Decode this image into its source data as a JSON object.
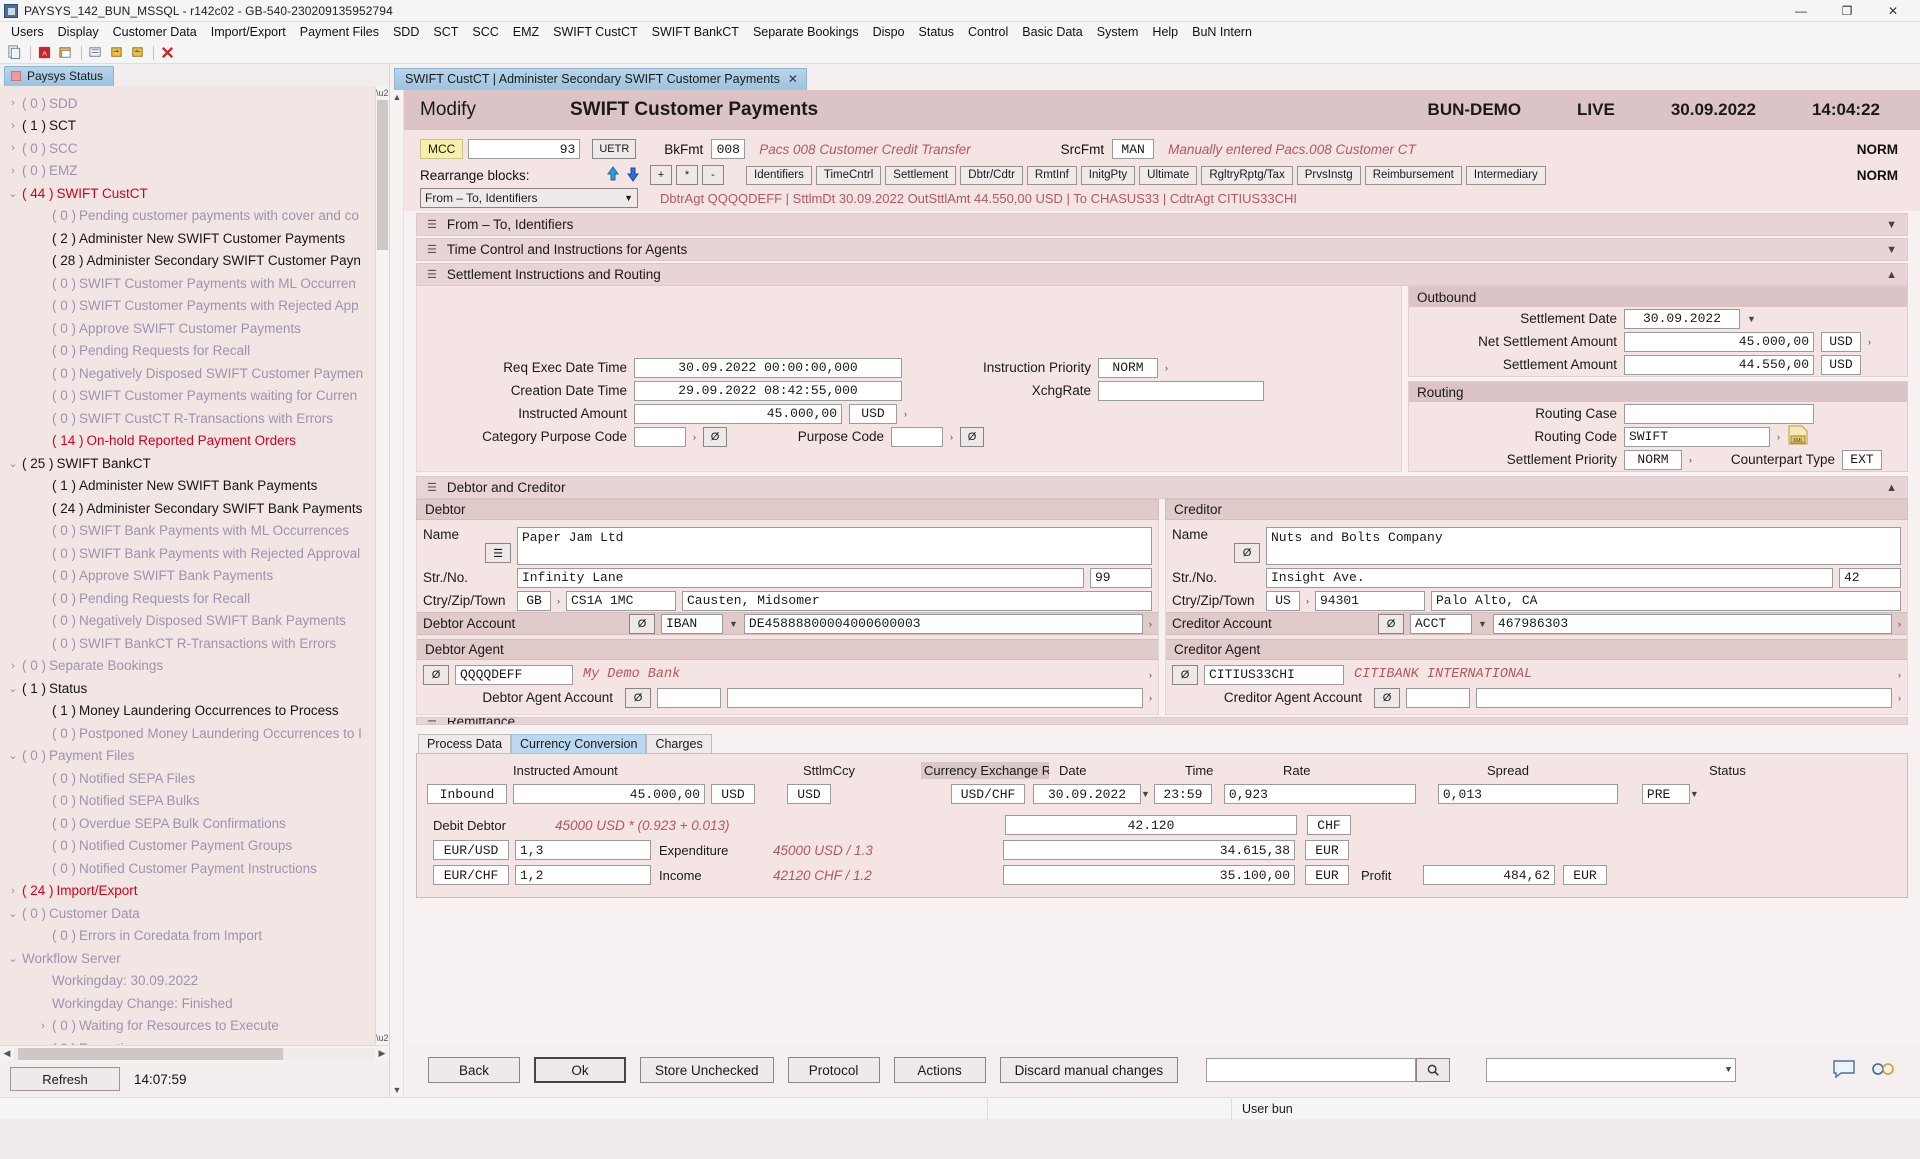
{
  "window": {
    "title": "PAYSYS_142_BUN_MSSQL - r142c02 - GB-540-230209135952794",
    "minimize": "—",
    "maximize": "❐",
    "close": "✕"
  },
  "menubar": [
    "Users",
    "Display",
    "Customer Data",
    "Import/Export",
    "Payment Files",
    "SDD",
    "SCT",
    "SCC",
    "EMZ",
    "SWIFT CustCT",
    "SWIFT BankCT",
    "Separate Bookings",
    "Dispo",
    "Status",
    "Control",
    "Basic Data",
    "System",
    "Help",
    "BuN Intern"
  ],
  "toolbar": {
    "icons": [
      "copy-icon",
      "pdf-icon",
      "print-icon",
      "attach-icon",
      "import-icon",
      "export-icon",
      "delete-icon"
    ],
    "glyphs": [
      "⎘",
      "■",
      "⎙",
      "⌘",
      "↩",
      "↪",
      "✕"
    ]
  },
  "sidebar": {
    "tab": "Paysys Status",
    "tree": [
      {
        "w": "›",
        "count": "( 0 )",
        "label": "SDD",
        "style": "dim",
        "level": 1
      },
      {
        "w": "›",
        "count": "( 1 )",
        "label": "SCT",
        "style": "bold",
        "level": 1
      },
      {
        "w": "›",
        "count": "( 0 )",
        "label": "SCC",
        "style": "dim",
        "level": 1
      },
      {
        "w": "›",
        "count": "( 0 )",
        "label": "EMZ",
        "style": "dim",
        "level": 1
      },
      {
        "w": "⌄",
        "count": "( 44 )",
        "label": "SWIFT CustCT",
        "style": "red",
        "level": 1
      },
      {
        "w": "",
        "count": "( 0 )",
        "label": "Pending customer payments with cover and co",
        "style": "dim",
        "level": 2
      },
      {
        "w": "",
        "count": "( 2 )",
        "label": "Administer New SWIFT Customer Payments",
        "style": "bold",
        "level": 2
      },
      {
        "w": "",
        "count": "( 28 )",
        "label": "Administer Secondary SWIFT Customer Payn",
        "style": "bold",
        "level": 2
      },
      {
        "w": "",
        "count": "( 0 )",
        "label": "SWIFT Customer Payments with ML Occurren",
        "style": "dim",
        "level": 2
      },
      {
        "w": "",
        "count": "( 0 )",
        "label": "SWIFT Customer Payments with Rejected App",
        "style": "dim",
        "level": 2
      },
      {
        "w": "",
        "count": "( 0 )",
        "label": "Approve SWIFT Customer Payments",
        "style": "dim",
        "level": 2
      },
      {
        "w": "",
        "count": "( 0 )",
        "label": "Pending Requests for Recall",
        "style": "dim",
        "level": 2
      },
      {
        "w": "",
        "count": "( 0 )",
        "label": "Negatively Disposed SWIFT Customer Paymen",
        "style": "dim",
        "level": 2
      },
      {
        "w": "",
        "count": "( 0 )",
        "label": "SWIFT Customer Payments waiting for Curren",
        "style": "dim",
        "level": 2
      },
      {
        "w": "",
        "count": "( 0 )",
        "label": "SWIFT CustCT R-Transactions with Errors",
        "style": "dim",
        "level": 2
      },
      {
        "w": "",
        "count": "( 14 )",
        "label": "On-hold Reported Payment Orders",
        "style": "red",
        "level": 2
      },
      {
        "w": "⌄",
        "count": "( 25 )",
        "label": "SWIFT BankCT",
        "style": "bold",
        "level": 1
      },
      {
        "w": "",
        "count": "( 1 )",
        "label": "Administer New SWIFT Bank Payments",
        "style": "bold",
        "level": 2
      },
      {
        "w": "",
        "count": "( 24 )",
        "label": "Administer Secondary SWIFT Bank Payments",
        "style": "bold",
        "level": 2
      },
      {
        "w": "",
        "count": "( 0 )",
        "label": "SWIFT Bank Payments with ML Occurrences",
        "style": "dim",
        "level": 2
      },
      {
        "w": "",
        "count": "( 0 )",
        "label": "SWIFT Bank Payments with Rejected Approval",
        "style": "dim",
        "level": 2
      },
      {
        "w": "",
        "count": "( 0 )",
        "label": "Approve SWIFT Bank Payments",
        "style": "dim",
        "level": 2
      },
      {
        "w": "",
        "count": "( 0 )",
        "label": "Pending Requests for Recall",
        "style": "dim",
        "level": 2
      },
      {
        "w": "",
        "count": "( 0 )",
        "label": "Negatively Disposed SWIFT Bank Payments",
        "style": "dim",
        "level": 2
      },
      {
        "w": "",
        "count": "( 0 )",
        "label": "SWIFT BankCT R-Transactions with Errors",
        "style": "dim",
        "level": 2
      },
      {
        "w": "›",
        "count": "( 0 )",
        "label": "Separate Bookings",
        "style": "dim",
        "level": 1
      },
      {
        "w": "⌄",
        "count": "( 1 )",
        "label": "Status",
        "style": "bold",
        "level": 1
      },
      {
        "w": "",
        "count": "( 1 )",
        "label": "Money Laundering Occurrences to Process",
        "style": "bold",
        "level": 2
      },
      {
        "w": "",
        "count": "( 0 )",
        "label": "Postponed Money Laundering Occurrences to I",
        "style": "dim",
        "level": 2
      },
      {
        "w": "⌄",
        "count": "( 0 )",
        "label": "Payment Files",
        "style": "dim",
        "level": 1
      },
      {
        "w": "",
        "count": "( 0 )",
        "label": "Notified SEPA Files",
        "style": "dim",
        "level": 2
      },
      {
        "w": "",
        "count": "( 0 )",
        "label": "Notified SEPA Bulks",
        "style": "dim",
        "level": 2
      },
      {
        "w": "",
        "count": "( 0 )",
        "label": "Overdue SEPA Bulk Confirmations",
        "style": "dim",
        "level": 2
      },
      {
        "w": "",
        "count": "( 0 )",
        "label": "Notified Customer Payment Groups",
        "style": "dim",
        "level": 2
      },
      {
        "w": "",
        "count": "( 0 )",
        "label": "Notified Customer Payment Instructions",
        "style": "dim",
        "level": 2
      },
      {
        "w": "›",
        "count": "( 24 )",
        "label": "Import/Export",
        "style": "red",
        "level": 1
      },
      {
        "w": "⌄",
        "count": "( 0 )",
        "label": "Customer Data",
        "style": "dim",
        "level": 1
      },
      {
        "w": "",
        "count": "( 0 )",
        "label": "Errors in Coredata from Import",
        "style": "dim",
        "level": 2
      },
      {
        "w": "⌄",
        "count": "",
        "label": "Workflow Server",
        "style": "dim",
        "level": 1
      },
      {
        "w": "",
        "count": "",
        "label": "Workingday: 30.09.2022",
        "style": "dim",
        "level": 2
      },
      {
        "w": "",
        "count": "",
        "label": "Workingday Change: Finished",
        "style": "dim",
        "level": 2
      },
      {
        "w": "›",
        "count": "( 0 )",
        "label": "Waiting for Resources to Execute",
        "style": "dim",
        "level": 2
      },
      {
        "w": "",
        "count": "( 0 )",
        "label": "Executing",
        "style": "dim",
        "level": 2
      }
    ],
    "refresh_label": "Refresh",
    "time": "14:07:59"
  },
  "doc_tab": {
    "label": "SWIFT CustCT | Administer Secondary SWIFT Customer Payments",
    "close": "✕"
  },
  "header": {
    "mode": "Modify",
    "title": "SWIFT Customer Payments",
    "env": "BUN-DEMO",
    "live": "LIVE",
    "date": "30.09.2022",
    "time": "14:04:22"
  },
  "idrow": {
    "mcc_label": "MCC",
    "mcc_value": "93",
    "uetr_label": "UETR",
    "bkfmt_label": "BkFmt",
    "bkfmt_value": "008",
    "bkfmt_desc": "Pacs 008  Customer Credit Transfer",
    "srcfmt_label": "SrcFmt",
    "srcfmt_value": "MAN",
    "srcfmt_desc": "Manually entered Pacs.008 Customer CT",
    "norm1": "NORM",
    "norm2": "NORM"
  },
  "rearrange": {
    "label": "Rearrange blocks:",
    "up": "⬆",
    "down": "⬇",
    "plus": "+",
    "star": "*",
    "minus": "-",
    "blocks": [
      "Identifiers",
      "TimeCntrl",
      "Settlement",
      "Dbtr/Cdtr",
      "RmtInf",
      "InitgPty",
      "Ultimate",
      "RgltryRptg/Tax",
      "PrvsInstg",
      "Reimbursement",
      "Intermediary"
    ],
    "select_value": "From – To, Identifiers",
    "summary": "DbtrAgt QQQQDEFF  |  SttlmDt 30.09.2022 OutSttlAmt 44.550,00 USD  |  To CHASUS33  |  CdtrAgt CITIUS33CHI"
  },
  "sections": {
    "from_to": "From – To, Identifiers",
    "time_control": "Time Control and Instructions for Agents",
    "settlement": "Settlement Instructions and Routing",
    "debtor_creditor": "Debtor and Creditor",
    "remittance": "Remittance"
  },
  "settlement_left": {
    "req_exec_label": "Req Exec Date Time",
    "req_exec_value": "30.09.2022 00:00:00,000",
    "creation_label": "Creation Date Time",
    "creation_value": "29.09.2022 08:42:55,000",
    "instructed_label": "Instructed Amount",
    "instructed_value": "45.000,00",
    "instructed_ccy": "USD",
    "catpurp_label": "Category Purpose  Code",
    "catpurp_value": "",
    "purp_label": "Purpose  Code",
    "purp_value": "",
    "instr_prio_label": "Instruction Priority",
    "instr_prio_value": "NORM",
    "xchg_label": "XchgRate",
    "xchg_value": ""
  },
  "outbound": {
    "title": "Outbound",
    "settlement_date_label": "Settlement Date",
    "settlement_date_value": "30.09.2022",
    "net_amount_label": "Net Settlement Amount",
    "net_amount_value": "45.000,00",
    "net_ccy": "USD",
    "amount_label": "Settlement Amount",
    "amount_value": "44.550,00",
    "ccy": "USD"
  },
  "routing": {
    "title": "Routing",
    "case_label": "Routing Case",
    "case_value": "",
    "code_label": "Routing Code",
    "code_value": "SWIFT",
    "xml_icon": "XML",
    "priority_label": "Settlement Priority",
    "priority_value": "NORM",
    "counterpart_label": "Counterpart Type",
    "counterpart_value": "EXT"
  },
  "debtor": {
    "title": "Debtor",
    "name_label": "Name",
    "name_value": "Paper Jam Ltd",
    "str_label": "Str./No.",
    "str_value": "Infinity Lane",
    "no_value": "99",
    "ctry_label": "Ctry/Zip/Town",
    "ctry_value": "GB",
    "zip_value": "CS1A 1MC",
    "town_value": "Causten, Midsomer",
    "account_label": "Debtor Account",
    "account_type": "IBAN",
    "account_value": "DE45888800004000600003",
    "agent_title": "Debtor Agent",
    "agent_bic": "QQQQDEFF",
    "agent_name": "My Demo Bank",
    "agent_account_label": "Debtor Agent Account",
    "agent_account_value": ""
  },
  "creditor": {
    "title": "Creditor",
    "name_label": "Name",
    "name_value": "Nuts and Bolts Company",
    "str_label": "Str./No.",
    "str_value": "Insight Ave.",
    "no_value": "42",
    "ctry_label": "Ctry/Zip/Town",
    "ctry_value": "US",
    "zip_value": "94301",
    "town_value": "Palo Alto, CA",
    "account_label": "Creditor Account",
    "account_type": "ACCT",
    "account_value": "467986303",
    "agent_title": "Creditor Agent",
    "agent_bic": "CITIUS33CHI",
    "agent_name": "CITIBANK INTERNATIONAL",
    "agent_account_label": "Creditor Agent Account",
    "agent_account_value": ""
  },
  "bottom_tabs": [
    {
      "label": "Process Data",
      "active": false
    },
    {
      "label": "Currency Conversion",
      "active": true
    },
    {
      "label": "Charges",
      "active": false
    }
  ],
  "conversion": {
    "inbound": "Inbound",
    "instructed_amount_label": "Instructed Amount",
    "instructed_amount_value": "45.000,00",
    "instructed_ccy": "USD",
    "sttlm_ccy_label": "SttlmCcy",
    "sttlm_ccy_value": "USD",
    "fx_rate_label": "Currency Exchange Rat",
    "fx_pair": "USD/CHF",
    "date_label": "Date",
    "date_value": "30.09.2022",
    "time_label": "Time",
    "time_value": "23:59",
    "rate_label": "Rate",
    "rate_value": "0,923",
    "spread_label": "Spread",
    "spread_value": "0,013",
    "status_label": "Status",
    "status_value": "PRE",
    "debit_debtor_label": "Debit Debtor",
    "debit_formula": "45000 USD * (0.923 + 0.013)",
    "debit_value": "42.120",
    "debit_ccy": "CHF",
    "eurusd_label": "EUR/USD",
    "eurusd_value": "1,3",
    "eurchf_label": "EUR/CHF",
    "eurchf_value": "1,2",
    "expenditure_label": "Expenditure",
    "expenditure_formula": "45000 USD / 1.3",
    "expenditure_value": "34.615,38",
    "expenditure_ccy": "EUR",
    "income_label": "Income",
    "income_formula": "42120 CHF / 1.2",
    "income_value": "35.100,00",
    "income_ccy": "EUR",
    "profit_label": "Profit",
    "profit_value": "484,62",
    "profit_ccy": "EUR"
  },
  "footer": {
    "buttons": [
      "Back",
      "Ok",
      "Store Unchecked",
      "Protocol",
      "Actions",
      "Discard manual changes"
    ],
    "search_value": "",
    "search_icon": "⌕",
    "dropdown_value": "",
    "chat_icon": "⌨",
    "tools_icon": "⚙"
  },
  "statusbar": {
    "user": "User bun"
  },
  "colors": {
    "accent": "#dcc3c6",
    "yellow": "#f7f0a8",
    "red": "#d0021b",
    "italic": "#b4575f"
  }
}
